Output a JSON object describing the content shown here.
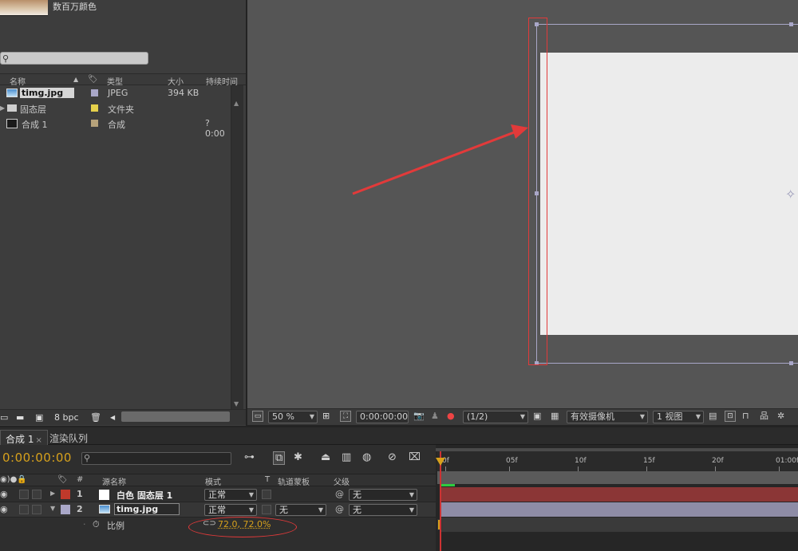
{
  "project": {
    "thumb_info": "数百万颜色",
    "columns": {
      "name": "名称",
      "type": "类型",
      "size": "大小",
      "duration": "持续时间"
    },
    "items": [
      {
        "name": "timg.jpg",
        "type": "JPEG",
        "size": "394 KB",
        "duration": "",
        "color": "#a9a7c8",
        "selected": true
      },
      {
        "name": "固态层",
        "type": "文件夹",
        "size": "",
        "duration": "",
        "color": "#e5d04b"
      },
      {
        "name": "合成 1",
        "type": "合成",
        "size": "",
        "duration": "? 0:00",
        "color": "#b6a27a"
      }
    ],
    "footer": {
      "bpc": "8 bpc"
    }
  },
  "viewer": {
    "zoom": "50 %",
    "timecode": "0:00:00:00",
    "resolution": "(1/2)",
    "camera": "有效摄像机",
    "views": "1 视图"
  },
  "tabs": [
    {
      "label": "合成 1",
      "active": true
    },
    {
      "label": "渲染队列",
      "active": false
    }
  ],
  "timeline": {
    "timecode": "0:00:00:00",
    "headers": {
      "source_name": "源名称",
      "mode": "模式",
      "t": "T",
      "trkmat": "轨道蒙板",
      "parent": "父级"
    },
    "layers": [
      {
        "num": "1",
        "name": "白色 固态层 1",
        "mode": "正常",
        "trkmat": "",
        "parent": "无",
        "color": "#c0392b"
      },
      {
        "num": "2",
        "name": "timg.jpg",
        "mode": "正常",
        "trkmat": "无",
        "parent": "无",
        "color": "#a9a7c8"
      }
    ],
    "property": {
      "name": "比例",
      "value": "72.0, 72.0%"
    },
    "ruler": [
      "0f",
      "05f",
      "10f",
      "15f",
      "20f",
      "01:00f"
    ]
  },
  "colors": {
    "accent": "#d7a11c",
    "annotation": "#e23a3a",
    "layer1_bar": "#8b3636",
    "layer2_bar": "#8e8ca6"
  }
}
